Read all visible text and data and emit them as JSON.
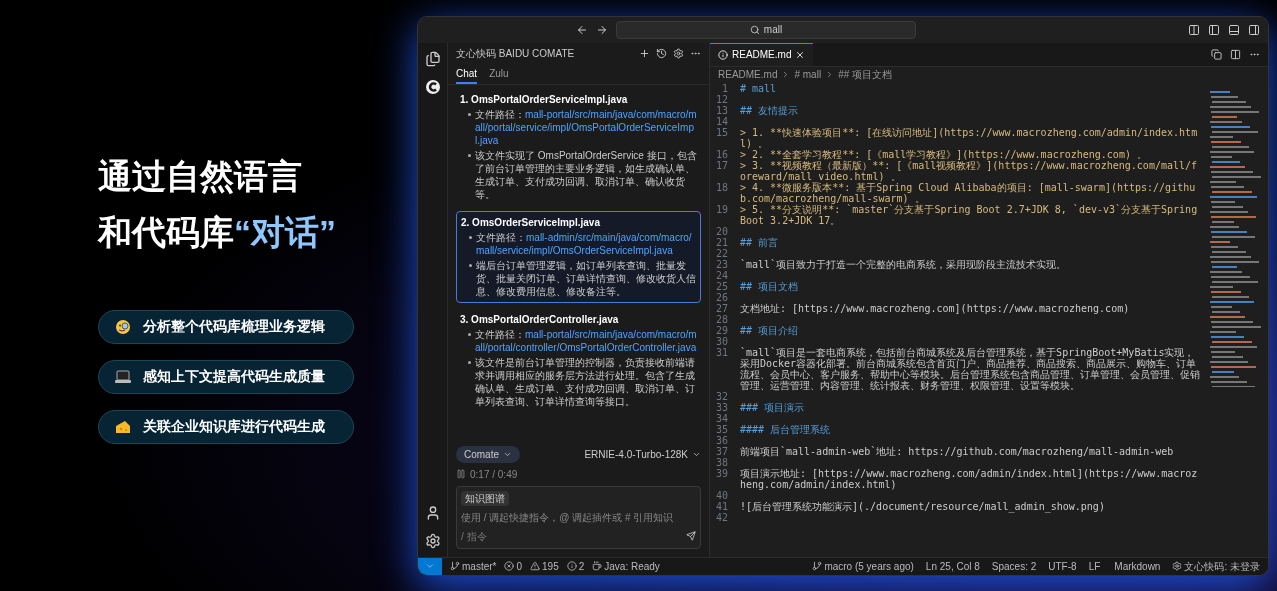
{
  "hero": {
    "title_line_1": "通过自然语言",
    "title_line_2": "和代码库",
    "title_highlight": "“对话”",
    "features": [
      {
        "kind": "face",
        "label": "分析整个代码库梳理业务逻辑"
      },
      {
        "kind": "laptop",
        "label": "感知上下文提高代码生成质量"
      },
      {
        "kind": "cheese",
        "label": "关联企业知识库进行代码生成"
      }
    ]
  },
  "window": {
    "search": "mall",
    "chat": {
      "title": "文心快码 BAIDU COMATE",
      "tabs": [
        {
          "label": "Chat",
          "selected": true
        },
        {
          "label": "Zulu",
          "selected": false
        }
      ],
      "items": [
        {
          "title": "1. OmsPortalOrderServiceImpl.java",
          "highlighted": false,
          "path_label": "文件路径：",
          "path": "mall-portal/src/main/java/com/macro/mall/portal/service/impl/OmsPortalOrderServiceImpl.java",
          "description": "该文件实现了 OmsPortalOrderService 接口，包含了前台订单管理的主要业务逻辑，如生成确认单、生成订单、支付成功回调、取消订单、确认收货等。"
        },
        {
          "title": "2. OmsOrderServiceImpl.java",
          "highlighted": true,
          "path_label": "文件路径：",
          "path": "mall-admin/src/main/java/com/macro/mall/service/impl/OmsOrderServiceImpl.java",
          "description": "端后台订单管理逻辑，如订单列表查询、批量发货、批量关闭订单、订单详情查询、修改收货人信息、修改费用信息、修改备注等。"
        },
        {
          "title": "3. OmsPortalOrderController.java",
          "highlighted": false,
          "path_label": "文件路径：",
          "path": "mall-portal/src/main/java/com/macro/mall/portal/controller/OmsPortalOrderController.java",
          "description": "该文件是前台订单管理的控制器，负责接收前端请求并调用相应的服务层方法进行处理。包含了生成确认单、生成订单、支付成功回调、取消订单、订单列表查询、订单详情查询等接口。"
        }
      ],
      "agent": "Comate",
      "model": "ERNIE-4.0-Turbo-128K",
      "video_time": "0:17 / 0:49",
      "input": {
        "tag": "知识图谱",
        "placeholder": "使用 / 调起快捷指令，@ 调起插件或 # 引用知识",
        "hint": "/ 指令"
      }
    },
    "editor": {
      "tab": "README.md",
      "breadcrumb": [
        "README.md",
        "# mall",
        "## 项目文档"
      ],
      "lines": [
        {
          "n": "1",
          "kind": "heading",
          "text": "# mall"
        },
        {
          "n": "12"
        },
        {
          "n": "13",
          "kind": "heading",
          "text": "## 友情提示"
        },
        {
          "n": "14"
        },
        {
          "n": "15",
          "kind": "quote",
          "text": "> 1. **快速体验项目**: [在线访问地址](https://www.macrozheng.com/admin/index.html) 。"
        },
        {
          "n": "16",
          "kind": "quote",
          "text": "> 2. **全套学习教程**: [《mall学习教程》](https://www.macrozheng.com) 。"
        },
        {
          "n": "17",
          "kind": "quote",
          "text": "> 3. **视频教程（最新版）**: [《mall视频教程》](https://www.macrozheng.com/mall/foreward/mall_video.html) 。"
        },
        {
          "n": "18",
          "kind": "quote",
          "text": "> 4. **微服务版本**: 基于Spring Cloud Alibaba的项目: [mall-swarm](https://github.com/macrozheng/mall-swarm) 。"
        },
        {
          "n": "19",
          "kind": "quote",
          "text": "> 5. **分支说明**: `master`分支基于Spring Boot 2.7+JDK 8, `dev-v3`分支基于Spring Boot 3.2+JDK 17。"
        },
        {
          "n": "20"
        },
        {
          "n": "21",
          "kind": "heading",
          "text": "## 前言"
        },
        {
          "n": "22"
        },
        {
          "n": "23",
          "kind": "text",
          "text": "`mall`项目致力于打造一个完整的电商系统，采用现阶段主流技术实现。"
        },
        {
          "n": "24"
        },
        {
          "n": "25",
          "kind": "heading",
          "text": "## 项目文档"
        },
        {
          "n": "26"
        },
        {
          "n": "27",
          "kind": "text",
          "text": "文档地址: [https://www.macrozheng.com](https://www.macrozheng.com)"
        },
        {
          "n": "28"
        },
        {
          "n": "29",
          "kind": "heading",
          "text": "## 项目介绍"
        },
        {
          "n": "30"
        },
        {
          "n": "31",
          "kind": "text",
          "text": "`mall`项目是一套电商系统，包括前台商城系统及后台管理系统，基于SpringBoot+MyBatis实现，采用Docker容器化部署。前台商城系统包含首页门户、商品推荐、商品搜索、商品展示、购物车、订单流程、会员中心、客户服务、帮助中心等模块。后台管理系统包含商品管理、订单管理、会员管理、促销管理、运营管理、内容管理、统计报表、财务管理、权限管理、设置等模块。"
        },
        {
          "n": "32"
        },
        {
          "n": "33",
          "kind": "heading",
          "text": "### 项目演示"
        },
        {
          "n": "34"
        },
        {
          "n": "35",
          "kind": "heading",
          "text": "#### 后台管理系统"
        },
        {
          "n": "36"
        },
        {
          "n": "37",
          "kind": "text",
          "text": "前端项目`mall-admin-web`地址: https://github.com/macrozheng/mall-admin-web"
        },
        {
          "n": "38"
        },
        {
          "n": "39",
          "kind": "text",
          "text": "项目演示地址: [https://www.macrozheng.com/admin/index.html](https://www.macrozheng.com/admin/index.html)"
        },
        {
          "n": "40"
        },
        {
          "n": "41",
          "kind": "text",
          "text": "![后台管理系统功能演示](./document/resource/mall_admin_show.png)"
        },
        {
          "n": "42"
        }
      ]
    },
    "status_bar": {
      "left": [
        {
          "kind": "branch",
          "text": "master*"
        },
        {
          "kind": "errors",
          "text": "0"
        },
        {
          "kind": "warnings",
          "text": "195"
        },
        {
          "kind": "info",
          "text": "2"
        },
        {
          "kind": "java",
          "text": "Java: Ready"
        }
      ],
      "right": [
        {
          "kind": "blame",
          "text": "macro (5 years ago)"
        },
        {
          "kind": "plain",
          "text": "Ln 25, Col 8"
        },
        {
          "kind": "plain",
          "text": "Spaces: 2"
        },
        {
          "kind": "plain",
          "text": "UTF-8"
        },
        {
          "kind": "plain",
          "text": "LF"
        },
        {
          "kind": "language",
          "text": "Markdown"
        },
        {
          "kind": "comate",
          "text": "文心快码: 未登录"
        }
      ]
    }
  }
}
